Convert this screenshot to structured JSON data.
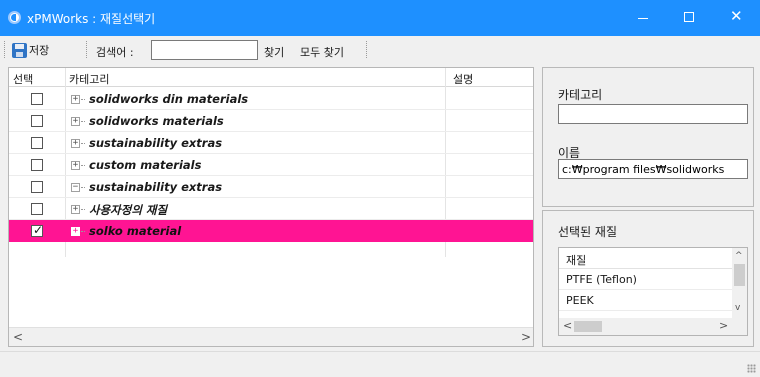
{
  "window": {
    "title": "xPMWorks : 재질선택기",
    "minimize_label": "—",
    "close_label": "✕"
  },
  "toolbar": {
    "save_label": "저장",
    "search_label": "검색어 :",
    "search_value": "",
    "find_label": "찾기",
    "find_all_label": "모두 찾기"
  },
  "grid": {
    "columns": [
      "선택",
      "카테고리",
      "설명"
    ],
    "rows": [
      {
        "checked": false,
        "expander": "+",
        "category": "solidworks din materials",
        "description": ""
      },
      {
        "checked": false,
        "expander": "+",
        "category": "solidworks materials",
        "description": ""
      },
      {
        "checked": false,
        "expander": "+",
        "category": "sustainability extras",
        "description": ""
      },
      {
        "checked": false,
        "expander": "+",
        "category": "custom materials",
        "description": ""
      },
      {
        "checked": false,
        "expander": "−",
        "category": "sustainability extras",
        "description": ""
      },
      {
        "checked": false,
        "expander": "+",
        "category": "사용자정의 재질",
        "description": ""
      },
      {
        "checked": true,
        "expander": "+",
        "category": "solko material",
        "description": ""
      }
    ],
    "selected_row": 6,
    "check_mark": "✓",
    "scroll_left": "<",
    "scroll_right": ">"
  },
  "details": {
    "category_label": "카테고리",
    "category_value": "",
    "name_label": "이름",
    "name_value": "c:₩program files₩solidworks"
  },
  "selected_materials": {
    "label": "선택된 재질",
    "column": "재질",
    "items": [
      "PTFE (Teflon)",
      "PEEK"
    ],
    "scroll_up": "^",
    "scroll_down": "v",
    "scroll_left": "<",
    "scroll_right": ">"
  },
  "colors": {
    "titlebar": "#1e90ff",
    "selected_row": "#ff1493",
    "background": "#f0f0f0"
  }
}
